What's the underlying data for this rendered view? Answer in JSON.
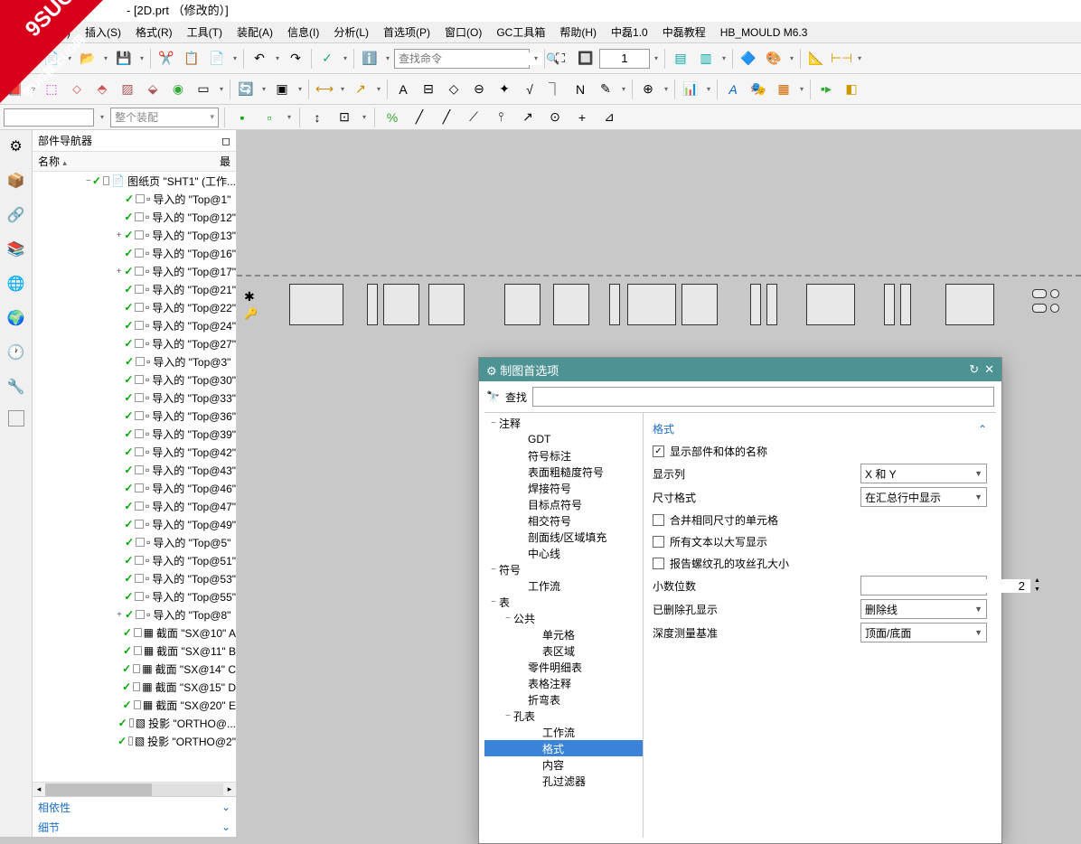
{
  "watermark": {
    "line1": "9SUG",
    "line2": "学UG就上UG网"
  },
  "title": "- [2D.prt （修改的）]",
  "menu": [
    "视图(V)",
    "插入(S)",
    "格式(R)",
    "工具(T)",
    "装配(A)",
    "信息(I)",
    "分析(L)",
    "首选项(P)",
    "窗口(O)",
    "GC工具箱",
    "帮助(H)",
    "中磊1.0",
    "中磊教程",
    "HB_MOULD M6.3"
  ],
  "toolbar": {
    "search_placeholder": "查找命令",
    "number_value": "1",
    "assembly_placeholder": "整个装配"
  },
  "nav": {
    "title": "部件导航器",
    "col_name": "名称",
    "col_last": "最",
    "foot1": "相依性",
    "foot2": "细节",
    "tree": [
      {
        "indent": 58,
        "exp": "−",
        "label": "图纸页 \"SHT1\" (工作...",
        "icon": "📄"
      },
      {
        "indent": 90,
        "exp": "",
        "label": "导入的 \"Top@1\"",
        "icon": "▫"
      },
      {
        "indent": 90,
        "exp": "",
        "label": "导入的 \"Top@12\"",
        "icon": "▫"
      },
      {
        "indent": 90,
        "exp": "+",
        "label": "导入的 \"Top@13\"",
        "icon": "▫"
      },
      {
        "indent": 90,
        "exp": "",
        "label": "导入的 \"Top@16\"",
        "icon": "▫"
      },
      {
        "indent": 90,
        "exp": "+",
        "label": "导入的 \"Top@17\"",
        "icon": "▫"
      },
      {
        "indent": 90,
        "exp": "",
        "label": "导入的 \"Top@21\"",
        "icon": "▫"
      },
      {
        "indent": 90,
        "exp": "",
        "label": "导入的 \"Top@22\"",
        "icon": "▫"
      },
      {
        "indent": 90,
        "exp": "",
        "label": "导入的 \"Top@24\"",
        "icon": "▫"
      },
      {
        "indent": 90,
        "exp": "",
        "label": "导入的 \"Top@27\"",
        "icon": "▫"
      },
      {
        "indent": 90,
        "exp": "",
        "label": "导入的 \"Top@3\"",
        "icon": "▫"
      },
      {
        "indent": 90,
        "exp": "",
        "label": "导入的 \"Top@30\"",
        "icon": "▫"
      },
      {
        "indent": 90,
        "exp": "",
        "label": "导入的 \"Top@33\"",
        "icon": "▫"
      },
      {
        "indent": 90,
        "exp": "",
        "label": "导入的 \"Top@36\"",
        "icon": "▫"
      },
      {
        "indent": 90,
        "exp": "",
        "label": "导入的 \"Top@39\"",
        "icon": "▫"
      },
      {
        "indent": 90,
        "exp": "",
        "label": "导入的 \"Top@42\"",
        "icon": "▫"
      },
      {
        "indent": 90,
        "exp": "",
        "label": "导入的 \"Top@43\"",
        "icon": "▫"
      },
      {
        "indent": 90,
        "exp": "",
        "label": "导入的 \"Top@46\"",
        "icon": "▫"
      },
      {
        "indent": 90,
        "exp": "",
        "label": "导入的 \"Top@47\"",
        "icon": "▫"
      },
      {
        "indent": 90,
        "exp": "",
        "label": "导入的 \"Top@49\"",
        "icon": "▫"
      },
      {
        "indent": 90,
        "exp": "",
        "label": "导入的 \"Top@5\"",
        "icon": "▫"
      },
      {
        "indent": 90,
        "exp": "",
        "label": "导入的 \"Top@51\"",
        "icon": "▫"
      },
      {
        "indent": 90,
        "exp": "",
        "label": "导入的 \"Top@53\"",
        "icon": "▫"
      },
      {
        "indent": 90,
        "exp": "",
        "label": "导入的 \"Top@55\"",
        "icon": "▫"
      },
      {
        "indent": 90,
        "exp": "+",
        "label": "导入的 \"Top@8\"",
        "icon": "▫"
      },
      {
        "indent": 90,
        "exp": "",
        "label": "截面 \"SX@10\" A",
        "icon": "▦"
      },
      {
        "indent": 90,
        "exp": "",
        "label": "截面 \"SX@11\" B",
        "icon": "▦"
      },
      {
        "indent": 90,
        "exp": "",
        "label": "截面 \"SX@14\" C",
        "icon": "▦"
      },
      {
        "indent": 90,
        "exp": "",
        "label": "截面 \"SX@15\" D",
        "icon": "▦"
      },
      {
        "indent": 90,
        "exp": "",
        "label": "截面 \"SX@20\" E",
        "icon": "▦"
      },
      {
        "indent": 90,
        "exp": "",
        "label": "投影 \"ORTHO@...",
        "icon": "▧"
      },
      {
        "indent": 90,
        "exp": "",
        "label": "投影 \"ORTHO@2\"",
        "icon": "▧"
      }
    ]
  },
  "dialog": {
    "title": "制图首选项",
    "search_label": "查找",
    "tree": [
      {
        "pad": 4,
        "exp": "−",
        "label": "注释"
      },
      {
        "pad": 36,
        "exp": "",
        "label": "GDT"
      },
      {
        "pad": 36,
        "exp": "",
        "label": "符号标注"
      },
      {
        "pad": 36,
        "exp": "",
        "label": "表面粗糙度符号"
      },
      {
        "pad": 36,
        "exp": "",
        "label": "焊接符号"
      },
      {
        "pad": 36,
        "exp": "",
        "label": "目标点符号"
      },
      {
        "pad": 36,
        "exp": "",
        "label": "相交符号"
      },
      {
        "pad": 36,
        "exp": "",
        "label": "剖面线/区域填充"
      },
      {
        "pad": 36,
        "exp": "",
        "label": "中心线"
      },
      {
        "pad": 4,
        "exp": "−",
        "label": "符号"
      },
      {
        "pad": 36,
        "exp": "",
        "label": "工作流"
      },
      {
        "pad": 4,
        "exp": "−",
        "label": "表"
      },
      {
        "pad": 20,
        "exp": "−",
        "label": "公共"
      },
      {
        "pad": 52,
        "exp": "",
        "label": "单元格"
      },
      {
        "pad": 52,
        "exp": "",
        "label": "表区域"
      },
      {
        "pad": 36,
        "exp": "",
        "label": "零件明细表"
      },
      {
        "pad": 36,
        "exp": "",
        "label": "表格注释"
      },
      {
        "pad": 36,
        "exp": "",
        "label": "折弯表"
      },
      {
        "pad": 20,
        "exp": "−",
        "label": "孔表"
      },
      {
        "pad": 52,
        "exp": "",
        "label": "工作流"
      },
      {
        "pad": 52,
        "exp": "",
        "label": "格式",
        "sel": true
      },
      {
        "pad": 52,
        "exp": "",
        "label": "内容"
      },
      {
        "pad": 52,
        "exp": "",
        "label": "孔过滤器"
      }
    ],
    "section_title": "格式",
    "cb_show_name": "显示部件和体的名称",
    "cb_merge": "合并相同尺寸的单元格",
    "cb_uppercase": "所有文本以大写显示",
    "cb_thread": "报告螺纹孔的攻丝孔大小",
    "lbl_cols": "显示列",
    "val_cols": "X 和 Y",
    "lbl_dimfmt": "尺寸格式",
    "val_dimfmt": "在汇总行中显示",
    "lbl_decimals": "小数位数",
    "val_decimals": "2",
    "lbl_deleted": "已删除孔显示",
    "val_deleted": "删除线",
    "lbl_depth": "深度测量基准",
    "val_depth": "顶面/底面"
  }
}
